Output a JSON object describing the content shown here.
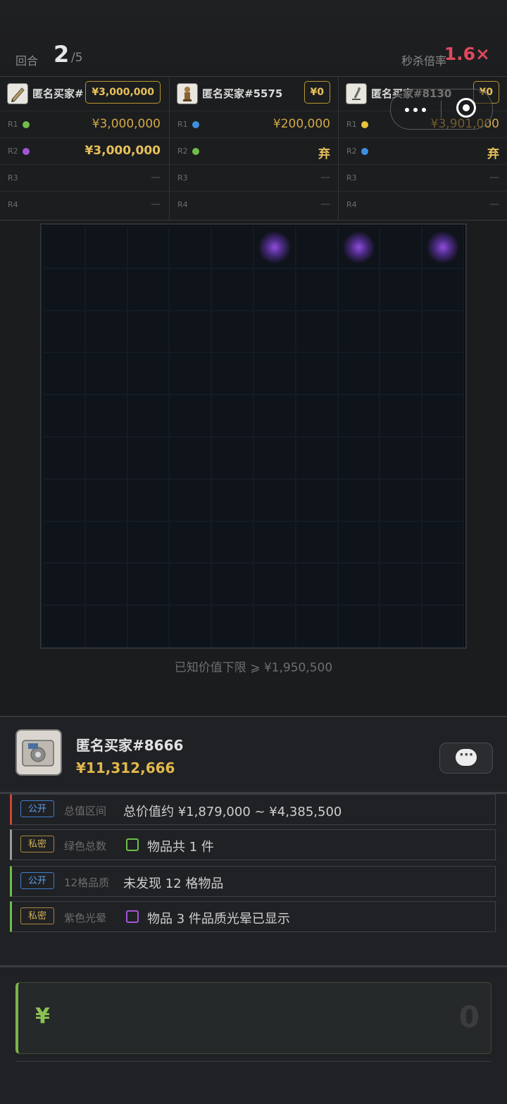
{
  "header": {
    "round_label": "回合",
    "round_current": "2",
    "round_total": "/5",
    "multiplier_label": "秒杀倍率",
    "multiplier_value": "1.6×"
  },
  "players": [
    {
      "name": "匿名买家#",
      "budget": "¥3,000,000",
      "icon": "pencil-icon",
      "rows": [
        {
          "label": "R1",
          "dot": "#6fbd4a",
          "value": "¥3,000,000",
          "bold": false
        },
        {
          "label": "R2",
          "dot": "#a355d6",
          "value": "¥3,000,000",
          "bold": true
        },
        {
          "label": "R3",
          "dot": "",
          "value": "—"
        },
        {
          "label": "R4",
          "dot": "",
          "value": "—"
        }
      ]
    },
    {
      "name": "匿名买家#5575",
      "budget": "¥0",
      "icon": "figurine-icon",
      "rows": [
        {
          "label": "R1",
          "dot": "#3f8fe0",
          "value": "¥200,000",
          "bold": false
        },
        {
          "label": "R2",
          "dot": "#6fbd4a",
          "value": "弃",
          "bold": true
        },
        {
          "label": "R3",
          "dot": "",
          "value": "—"
        },
        {
          "label": "R4",
          "dot": "",
          "value": "—"
        }
      ]
    },
    {
      "name": "匿名买家#8130",
      "budget": "¥0",
      "icon": "microscope-icon",
      "rows": [
        {
          "label": "R1",
          "dot": "#e8c53a",
          "value": "¥3,901,000",
          "bold": false
        },
        {
          "label": "R2",
          "dot": "#3f8fe0",
          "value": "弃",
          "bold": true
        },
        {
          "label": "R3",
          "dot": "",
          "value": "—"
        },
        {
          "label": "R4",
          "dot": "",
          "value": "—"
        }
      ]
    }
  ],
  "board": {
    "rows": 10,
    "cols": 10,
    "purple_glow_cells": [
      [
        0,
        5
      ],
      [
        0,
        7
      ],
      [
        0,
        9
      ]
    ]
  },
  "known_floor": "已知价值下限 ⩾ ¥1,950,500",
  "me": {
    "name": "匿名买家#8666",
    "money": "¥11,312,666"
  },
  "hints": [
    {
      "tag": "公开",
      "type": "public",
      "label": "总值区间",
      "text": "总价值约 ¥1,879,000 ~ ¥4,385,500",
      "bar": "#c9463a",
      "check": ""
    },
    {
      "tag": "私密",
      "type": "private",
      "label": "绿色总数",
      "text": "物品共 1 件",
      "bar": "#9a9a9a",
      "check": "#6fbd4a"
    },
    {
      "tag": "公开",
      "type": "public",
      "label": "12格品质",
      "text": "未发现 12 格物品",
      "bar": "#6fbd4a",
      "check": ""
    },
    {
      "tag": "私密",
      "type": "private",
      "label": "紫色光晕",
      "text": "物品 3 件品质光晕已显示",
      "bar": "#6fbd4a",
      "check": "#a355d6"
    }
  ],
  "bid": {
    "currency": "¥",
    "amount": "0"
  }
}
